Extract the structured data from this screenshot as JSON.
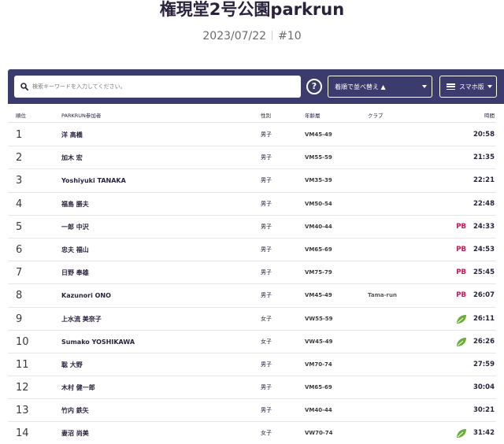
{
  "event": {
    "title": "権現堂2号公園parkrun",
    "date": "2023/07/22",
    "number": "#10"
  },
  "toolbar": {
    "search_placeholder": "検索キーワードを入力してください。",
    "help_label": "?",
    "sort_label": "着順で並べ替え ▲",
    "view_label": "スマホ版"
  },
  "columns": {
    "position": "順位",
    "name": "PARKRUN参加者",
    "gender": "性別",
    "age_group": "年齢層",
    "club": "クラブ",
    "time": "時間"
  },
  "colors": {
    "toolbar_bg": "#3c3b6e",
    "pb": "#c2185b",
    "first_timer_leaf": "#6cae3c"
  },
  "rows": [
    {
      "position": "1",
      "name": "洋 高橋",
      "gender": "男子",
      "age_group": "VM45-49",
      "club": "",
      "badge": "",
      "icon": "",
      "time": "20:58"
    },
    {
      "position": "2",
      "name": "加木 宏",
      "gender": "男子",
      "age_group": "VM55-59",
      "club": "",
      "badge": "",
      "icon": "",
      "time": "21:35"
    },
    {
      "position": "3",
      "name": "Yoshiyuki TANAKA",
      "gender": "男子",
      "age_group": "VM35-39",
      "club": "",
      "badge": "",
      "icon": "",
      "time": "22:21"
    },
    {
      "position": "4",
      "name": "福島 勝夫",
      "gender": "男子",
      "age_group": "VM50-54",
      "club": "",
      "badge": "",
      "icon": "",
      "time": "22:48"
    },
    {
      "position": "5",
      "name": "一郎 中沢",
      "gender": "男子",
      "age_group": "VM40-44",
      "club": "",
      "badge": "PB",
      "icon": "",
      "time": "24:33"
    },
    {
      "position": "6",
      "name": "忠夫 福山",
      "gender": "男子",
      "age_group": "VM65-69",
      "club": "",
      "badge": "PB",
      "icon": "",
      "time": "24:53"
    },
    {
      "position": "7",
      "name": "日野 奉雄",
      "gender": "男子",
      "age_group": "VM75-79",
      "club": "",
      "badge": "PB",
      "icon": "",
      "time": "25:45"
    },
    {
      "position": "8",
      "name": "Kazunori ONO",
      "gender": "男子",
      "age_group": "VM45-49",
      "club": "Tama-run",
      "badge": "PB",
      "icon": "",
      "time": "26:07"
    },
    {
      "position": "9",
      "name": "上水流 美奈子",
      "gender": "女子",
      "age_group": "VW55-59",
      "club": "",
      "badge": "",
      "icon": "leaf-icon",
      "time": "26:11"
    },
    {
      "position": "10",
      "name": "Sumako YOSHIKAWA",
      "gender": "女子",
      "age_group": "VW45-49",
      "club": "",
      "badge": "",
      "icon": "leaf-icon",
      "time": "26:26"
    },
    {
      "position": "11",
      "name": "聡 大野",
      "gender": "男子",
      "age_group": "VM70-74",
      "club": "",
      "badge": "",
      "icon": "",
      "time": "27:59"
    },
    {
      "position": "12",
      "name": "木村 健一郎",
      "gender": "男子",
      "age_group": "VM65-69",
      "club": "",
      "badge": "",
      "icon": "",
      "time": "30:04"
    },
    {
      "position": "13",
      "name": "竹内 鉄矢",
      "gender": "男子",
      "age_group": "VM40-44",
      "club": "",
      "badge": "",
      "icon": "",
      "time": "30:21"
    },
    {
      "position": "14",
      "name": "妻沼 尚美",
      "gender": "女子",
      "age_group": "VW70-74",
      "club": "",
      "badge": "",
      "icon": "leaf-icon",
      "time": "31:42"
    }
  ]
}
